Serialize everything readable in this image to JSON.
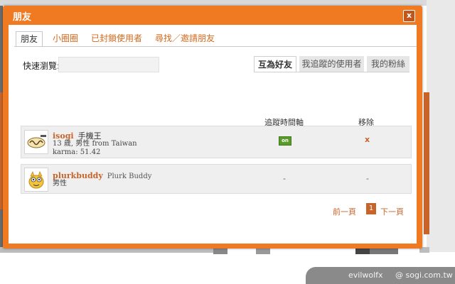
{
  "dialog": {
    "title": "朋友",
    "close_label": "x"
  },
  "tabs": [
    {
      "label": "朋友",
      "active": true
    },
    {
      "label": "小圈圈",
      "active": false
    },
    {
      "label": "已封鎖使用者",
      "active": false
    },
    {
      "label": "尋找／邀請朋友",
      "active": false
    }
  ],
  "quick_browse": {
    "label": "快速瀏覽:",
    "value": "",
    "placeholder": ""
  },
  "filter_tabs": [
    {
      "label": "互為好友",
      "active": true
    },
    {
      "label": "我追蹤的使用者",
      "active": false
    },
    {
      "label": "我的粉絲",
      "active": false
    }
  ],
  "columns": {
    "timeline": "追蹤時間軸",
    "remove": "移除"
  },
  "friends": [
    {
      "username": "isogi",
      "display_name": "手機王",
      "info": "13 歲, 男性 from Taiwan",
      "karma": "karma: 51.42",
      "timeline": "on",
      "remove": "x",
      "avatar_icon": "sogi-logo-icon"
    },
    {
      "username": "plurkbuddy",
      "display_name": "Plurk Buddy",
      "info": "男性",
      "karma": "",
      "timeline": "-",
      "remove": "-",
      "avatar_icon": "plurk-buddy-icon"
    }
  ],
  "pagination": {
    "prev": "前一頁",
    "current": "1",
    "next": "下一頁"
  },
  "watermark": {
    "left": "evilwolfx",
    "right": "@ sogi.com.tw"
  },
  "colors": {
    "accent": "#f07a22",
    "link": "#c8642a",
    "on": "#5a9a2a"
  }
}
